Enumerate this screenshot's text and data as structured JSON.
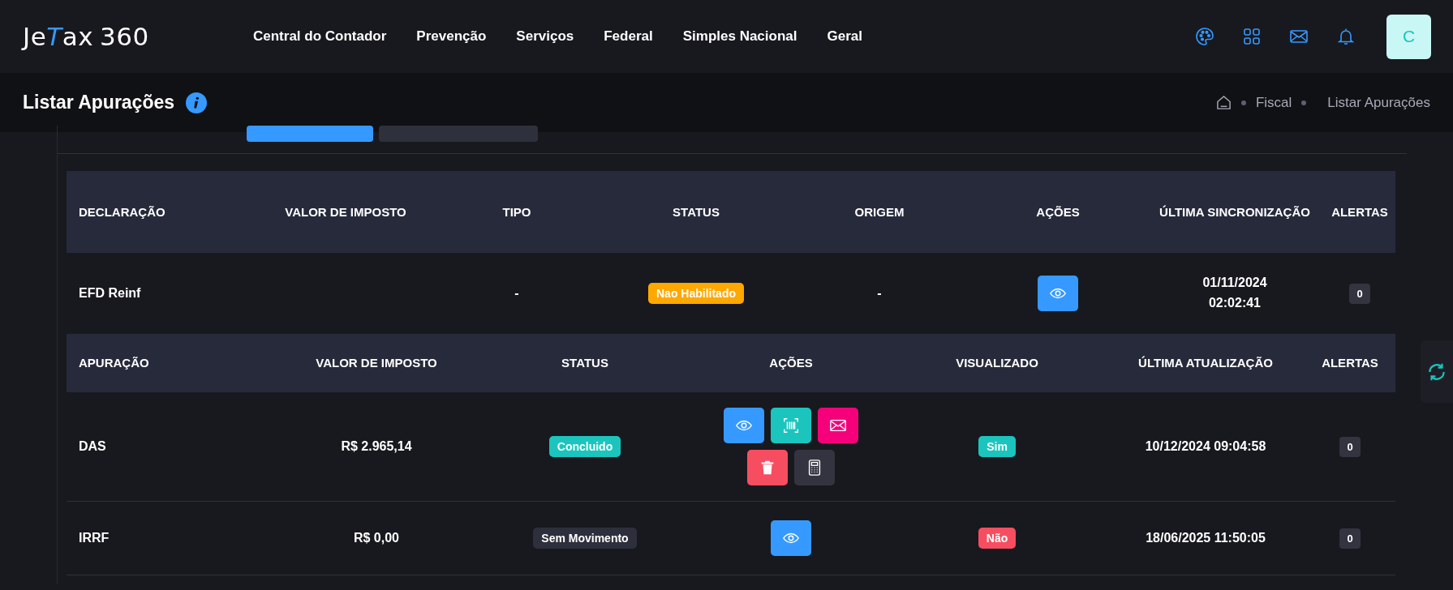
{
  "logo": {
    "parts": [
      "Je",
      "T",
      "ax",
      "360"
    ]
  },
  "nav": [
    "Central do Contador",
    "Prevenção",
    "Serviços",
    "Federal",
    "Simples Nacional",
    "Geral"
  ],
  "header_icons": [
    {
      "kind": "palette"
    },
    {
      "kind": "apps"
    },
    {
      "kind": "mail"
    },
    {
      "kind": "bell"
    }
  ],
  "avatar": "C",
  "page_title": "Listar Apurações",
  "breadcrumb": [
    "Fiscal",
    "Listar Apurações"
  ],
  "tags": [
    {
      "color": "#3699ff"
    },
    {
      "color": "#2e303c"
    }
  ],
  "declarations": {
    "columns": [
      "DECLARAÇÃO",
      "VALOR DE IMPOSTO",
      "TIPO",
      "STATUS",
      "ORIGEM",
      "AÇÕES",
      "ÚLTIMA SINCRONIZAÇÃO",
      "ALERTAS"
    ],
    "rows": [
      {
        "name": "EFD Reinf",
        "tipo": "-",
        "status": {
          "label": "Nao Habilitado",
          "color": "#ffa800"
        },
        "origem": "-",
        "actions": [
          {
            "kind": "view"
          }
        ],
        "sync": [
          "01/11/2024",
          "02:02:41"
        ],
        "alerts": "0"
      }
    ]
  },
  "apuracoes": {
    "columns": [
      "APURAÇÃO",
      "VALOR DE IMPOSTO",
      "STATUS",
      "AÇÕES",
      "VISUALIZADO",
      "ÚLTIMA ATUALIZAÇÃO",
      "ALERTAS"
    ],
    "rows": [
      {
        "name": "DAS",
        "value": "R$ 2.965,14",
        "status": {
          "label": "Concluido",
          "color": "#1bc5bd"
        },
        "actions": [
          {
            "kind": "view"
          },
          {
            "kind": "barcode"
          },
          {
            "kind": "mail"
          },
          {
            "kind": "delete"
          },
          {
            "kind": "calculator"
          }
        ],
        "viewed": {
          "label": "Sim",
          "color": "#1bc5bd"
        },
        "updated": "10/12/2024 09:04:58",
        "alerts": "0"
      },
      {
        "name": "IRRF",
        "value": "R$ 0,00",
        "status": {
          "label": "Sem Movimento",
          "color": "#2e2f3c"
        },
        "actions": [
          {
            "kind": "view"
          }
        ],
        "viewed": {
          "label": "Não",
          "color": "#f64e60"
        },
        "updated": "18/06/2025 11:50:05",
        "alerts": "0"
      }
    ]
  }
}
